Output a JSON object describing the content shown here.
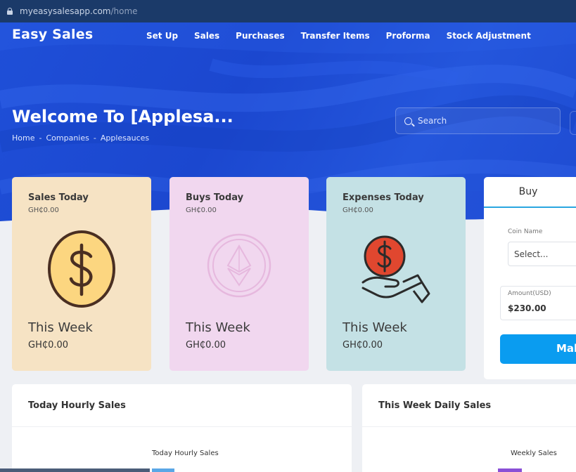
{
  "browser": {
    "url_host": "myeasysalesapp.com",
    "url_path": "/home"
  },
  "brand": "Easy Sales",
  "nav": [
    "Set Up",
    "Sales",
    "Purchases",
    "Transfer Items",
    "Proforma",
    "Stock Adjustment"
  ],
  "hero": {
    "welcome": "Welcome To [Applesa...",
    "breadcrumb": [
      "Home",
      "Companies",
      "Applesauces"
    ],
    "breadcrumb_sep": "-",
    "search_placeholder": "Search"
  },
  "cards": [
    {
      "title": "Sales Today",
      "amount": "GH₵0.00",
      "week_label": "This Week",
      "week_amount": "GH₵0.00",
      "icon": "dollar-coin-icon",
      "color": "#f6e3c4"
    },
    {
      "title": "Buys Today",
      "amount": "GH₵0.00",
      "week_label": "This Week",
      "week_amount": "GH₵0.00",
      "icon": "ethereum-coin-icon",
      "color": "#f1d7ef"
    },
    {
      "title": "Expenses Today",
      "amount": "GH₵0.00",
      "week_label": "This Week",
      "week_amount": "GH₵0.00",
      "icon": "hand-coin-icon",
      "color": "#c4e1e5"
    }
  ],
  "buy_panel": {
    "tab": "Buy",
    "coin_label": "Coin Name",
    "coin_value": "Select...",
    "amount_label": "Amount(USD)",
    "amount_value": "$230.00",
    "button_label": "Mak"
  },
  "panels": [
    {
      "title": "Today Hourly Sales",
      "chart_title": "Today Hourly Sales"
    },
    {
      "title": "This Week Daily Sales",
      "chart_title": "Weekly Sales"
    }
  ],
  "colors": {
    "hero": "#1f4fd8",
    "accent": "#0a9cf0",
    "tab_underline": "#2aa6e0"
  }
}
